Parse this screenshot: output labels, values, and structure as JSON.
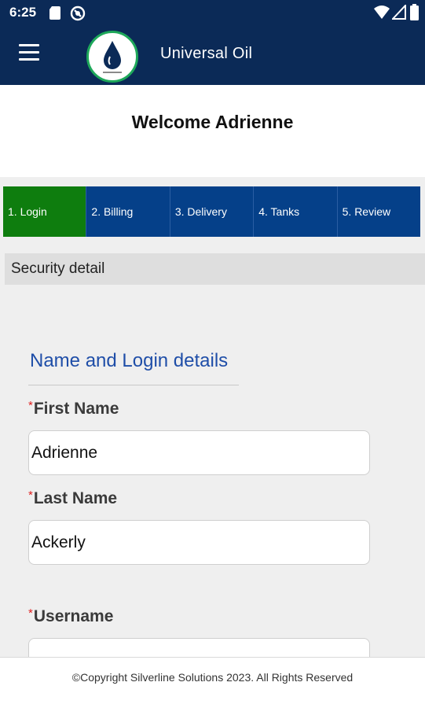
{
  "status_bar": {
    "time": "6:25",
    "left_icons": [
      "sd-card-icon",
      "sync-disabled-icon"
    ],
    "right_icons": [
      "wifi-icon",
      "signal-icon",
      "battery-icon"
    ]
  },
  "app_bar": {
    "title": "Universal Oil",
    "menu_icon": "hamburger-menu-icon",
    "logo": "universal-oil-logo"
  },
  "welcome": "Welcome Adrienne",
  "steps": [
    {
      "label": "1. Login",
      "active": true
    },
    {
      "label": "2. Billing",
      "active": false
    },
    {
      "label": "3. Delivery",
      "active": false
    },
    {
      "label": "4. Tanks",
      "active": false
    },
    {
      "label": "5. Review",
      "active": false
    }
  ],
  "section_title": "Security detail",
  "form": {
    "heading": "Name and Login details",
    "required_marker": "*",
    "fields": [
      {
        "label": "First Name",
        "value": "Adrienne"
      },
      {
        "label": "Last Name",
        "value": "Ackerly"
      },
      {
        "label": "Username",
        "value": ""
      }
    ]
  },
  "footer": "©Copyright Silverline Solutions 2023. All Rights Reserved",
  "colors": {
    "header_bg": "#0b2a57",
    "step_bg": "#054089",
    "step_active_bg": "#0e7d0e",
    "heading_blue": "#1f4ea8",
    "required_red": "#e01f1f",
    "logo_ring": "#1ea85a"
  }
}
